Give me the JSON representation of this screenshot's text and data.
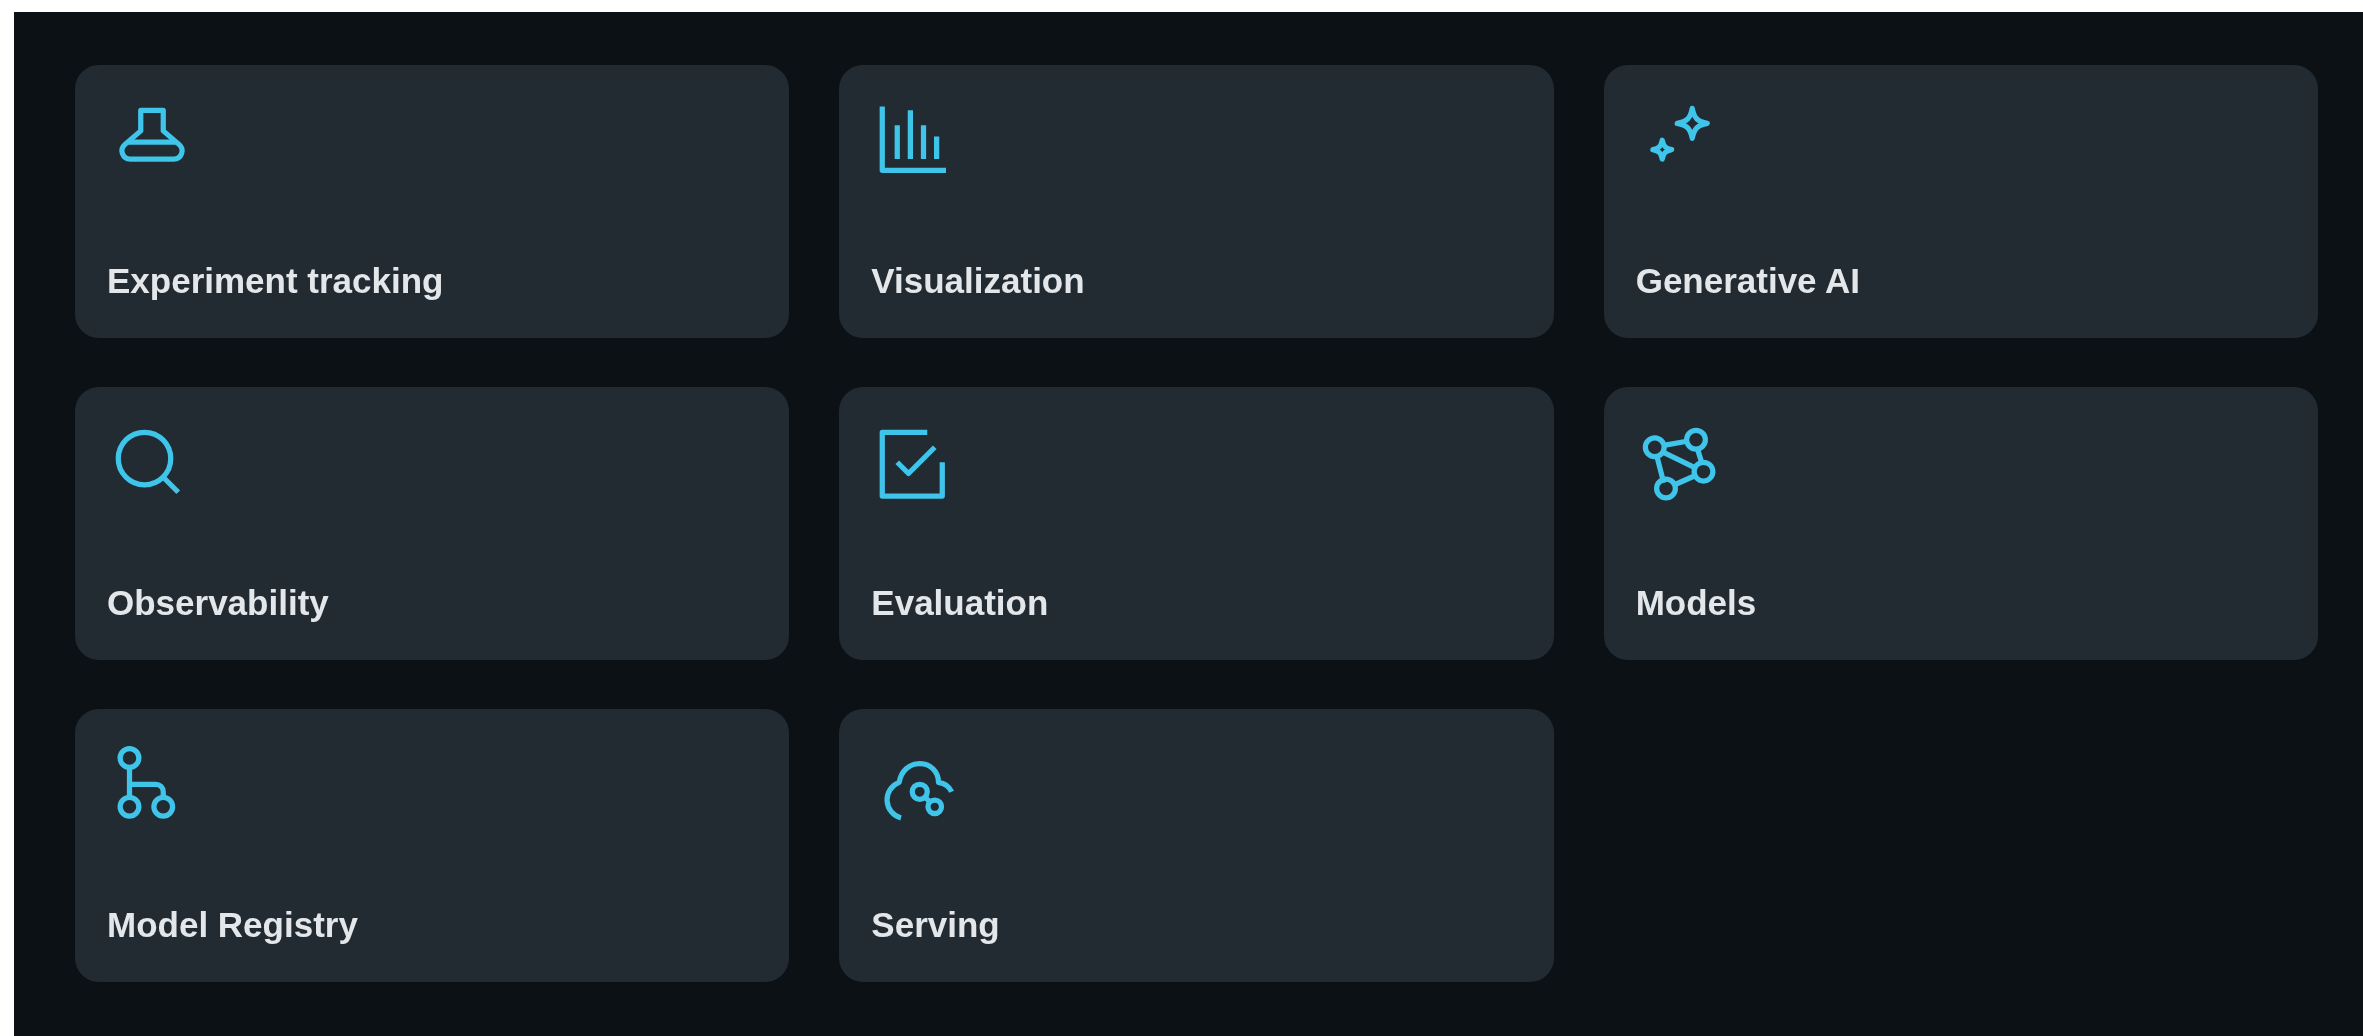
{
  "cards": [
    {
      "title": "Experiment tracking"
    },
    {
      "title": "Visualization"
    },
    {
      "title": "Generative AI"
    },
    {
      "title": "Observability"
    },
    {
      "title": "Evaluation"
    },
    {
      "title": "Models"
    },
    {
      "title": "Model Registry"
    },
    {
      "title": "Serving"
    }
  ]
}
